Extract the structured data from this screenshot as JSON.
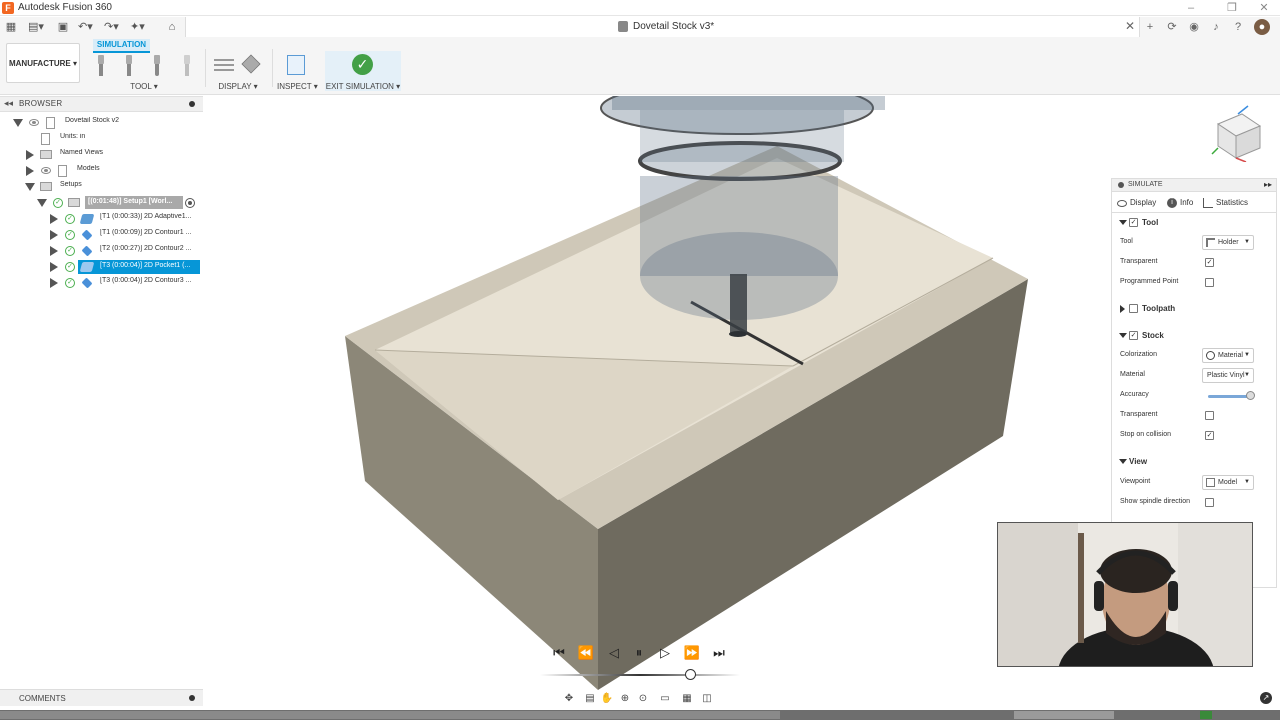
{
  "app": {
    "title": "Autodesk Fusion 360",
    "document_title": "Dovetail Stock v3*"
  },
  "toolbar": {
    "workspace": "MANUFACTURE",
    "active_tab": "SIMULATION",
    "groups": {
      "tool": "TOOL",
      "display": "DISPLAY",
      "inspect": "INSPECT",
      "exit": "EXIT SIMULATION"
    }
  },
  "browser": {
    "title": "BROWSER",
    "items": [
      {
        "label": "Dovetail Stock v2"
      },
      {
        "label": "Units: in"
      },
      {
        "label": "Named Views"
      },
      {
        "label": "Models"
      },
      {
        "label": "Setups"
      },
      {
        "label": "[(0:01:48)] Setup1 [Worl..."
      },
      {
        "label": "[T1 (0:00:33)] 2D Adaptive1..."
      },
      {
        "label": "[T1 (0:00:09)] 2D Contour1 ..."
      },
      {
        "label": "[T2 (0:00:27)] 2D Contour2 ..."
      },
      {
        "label": "[T3 (0:00:04)] 2D Pocket1 (..."
      },
      {
        "label": "[T3 (0:00:04)] 2D Contour3 ..."
      }
    ]
  },
  "comments": {
    "title": "COMMENTS"
  },
  "simulate": {
    "title": "SIMULATE",
    "tabs": [
      "Display",
      "Info",
      "Statistics"
    ],
    "tool_section": {
      "title": "Tool",
      "checked": true,
      "rows": {
        "tool_label": "Tool",
        "tool_value": "Holder",
        "transparent_label": "Transparent",
        "transparent_checked": true,
        "programmed_point_label": "Programmed Point",
        "programmed_point_checked": false
      }
    },
    "toolpath_section": {
      "title": "Toolpath",
      "checked": false
    },
    "stock_section": {
      "title": "Stock",
      "checked": true,
      "rows": {
        "colorization_label": "Colorization",
        "colorization_value": "Material",
        "material_label": "Material",
        "material_value": "Plastic Vinyl",
        "accuracy_label": "Accuracy",
        "accuracy_level": 0.95,
        "transparent_label": "Transparent",
        "transparent_checked": false,
        "stop_label": "Stop on collision",
        "stop_checked": true
      }
    },
    "view_section": {
      "title": "View",
      "rows": {
        "viewpoint_label": "Viewpoint",
        "viewpoint_value": "Model",
        "spindle_label": "Show spindle direction",
        "spindle_checked": false
      }
    }
  },
  "playback": {
    "progress": 0.75
  },
  "colors": {
    "accent": "#0696d7",
    "ok_green": "#43a047",
    "stock_top": "#e8e2d4",
    "stock_side": "#8c8778"
  }
}
